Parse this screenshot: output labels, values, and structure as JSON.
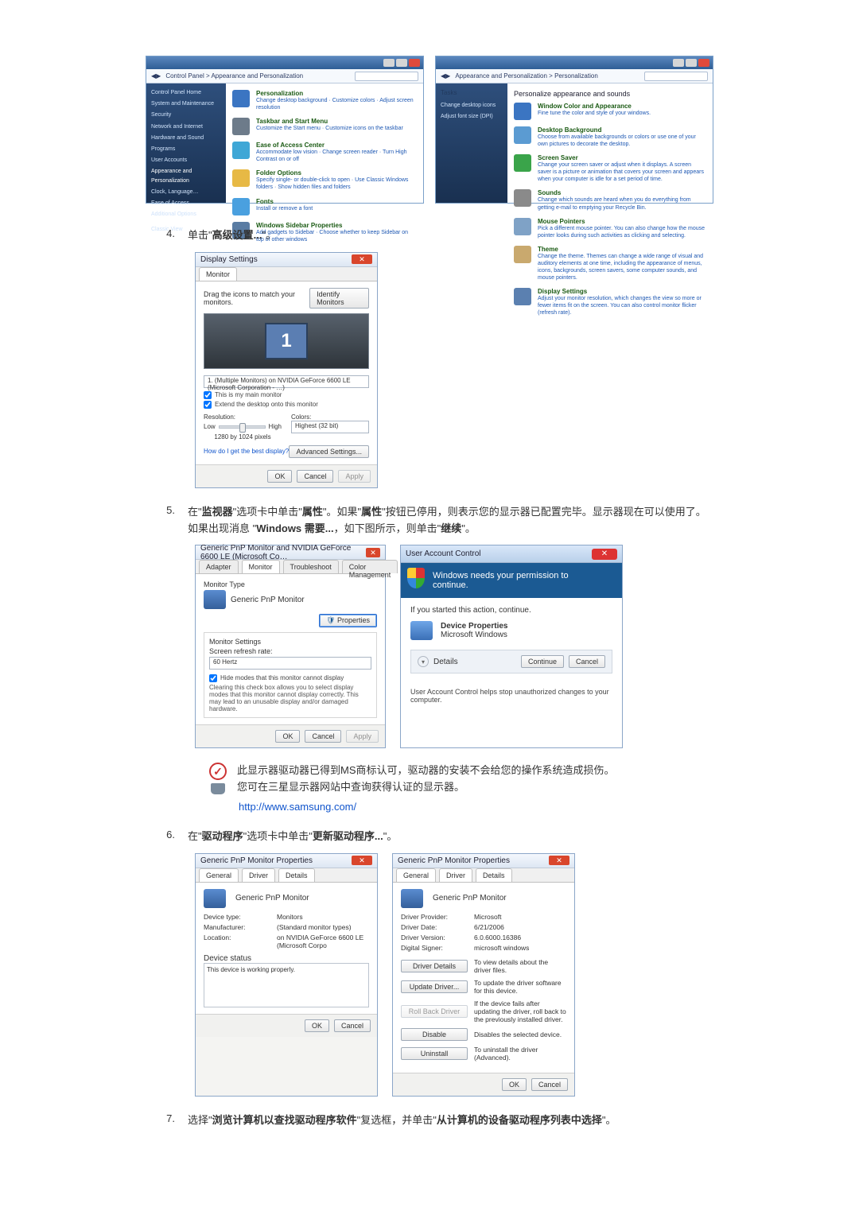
{
  "cp1": {
    "addr": "Control Panel > Appearance and Personalization",
    "side": [
      "Control Panel Home",
      "System and Maintenance",
      "Security",
      "Network and Internet",
      "Hardware and Sound",
      "Programs",
      "User Accounts",
      "Appearance and Personalization",
      "Clock, Language…",
      "Ease of Access",
      "Additional Options",
      "Classic View"
    ],
    "items": [
      {
        "h": "Personalization",
        "s": "Change desktop background · Customize colors · Adjust screen resolution",
        "color": "#3b75c2"
      },
      {
        "h": "Taskbar and Start Menu",
        "s": "Customize the Start menu · Customize icons on the taskbar",
        "color": "#6d7b8a"
      },
      {
        "h": "Ease of Access Center",
        "s": "Accommodate low vision · Change screen reader · Turn High Contrast on or off",
        "color": "#3fa7d6"
      },
      {
        "h": "Folder Options",
        "s": "Specify single- or double-click to open · Use Classic Windows folders · Show hidden files and folders",
        "color": "#e7b945"
      },
      {
        "h": "Fonts",
        "s": "Install or remove a font",
        "color": "#4aa0df"
      },
      {
        "h": "Windows Sidebar Properties",
        "s": "Add gadgets to Sidebar · Choose whether to keep Sidebar on top of other windows",
        "color": "#5a7ca3"
      }
    ]
  },
  "cp2": {
    "addr": "Appearance and Personalization > Personalization",
    "task_head": "Tasks",
    "side": [
      "Change desktop icons",
      "Adjust font size (DPI)"
    ],
    "main_head": "Personalize appearance and sounds",
    "items": [
      {
        "h": "Window Color and Appearance",
        "s": "Fine tune the color and style of your windows.",
        "color": "#3b75c2"
      },
      {
        "h": "Desktop Background",
        "s": "Choose from available backgrounds or colors or use one of your own pictures to decorate the desktop.",
        "color": "#5b9bd2"
      },
      {
        "h": "Screen Saver",
        "s": "Change your screen saver or adjust when it displays. A screen saver is a picture or animation that covers your screen and appears when your computer is idle for a set period of time.",
        "color": "#3aa44a"
      },
      {
        "h": "Sounds",
        "s": "Change which sounds are heard when you do everything from getting e-mail to emptying your Recycle Bin.",
        "color": "#8a8a8a"
      },
      {
        "h": "Mouse Pointers",
        "s": "Pick a different mouse pointer. You can also change how the mouse pointer looks during such activities as clicking and selecting.",
        "color": "#7fa2c6"
      },
      {
        "h": "Theme",
        "s": "Change the theme. Themes can change a wide range of visual and auditory elements at one time, including the appearance of menus, icons, backgrounds, screen savers, some computer sounds, and mouse pointers.",
        "color": "#c9a96e"
      },
      {
        "h": "Display Settings",
        "s": "Adjust your monitor resolution, which changes the view so more or fewer items fit on the screen. You can also control monitor flicker (refresh rate).",
        "color": "#5b80b0"
      }
    ]
  },
  "step4": {
    "num": "4.",
    "text_a": "单击\"",
    "bold": "高级设置...",
    "text_b": "\"。"
  },
  "ds": {
    "title": "Display Settings",
    "tab": "Monitor",
    "drag": "Drag the icons to match your monitors.",
    "identify": "Identify Monitors",
    "mon_num": "1",
    "mon_sel": "1. (Multiple Monitors) on NVIDIA GeForce 6600 LE (Microsoft Corporation - …)",
    "chk1": "This is my main monitor",
    "chk2": "Extend the desktop onto this monitor",
    "res_label": "Resolution:",
    "low": "Low",
    "high": "High",
    "res_val": "1280 by 1024 pixels",
    "col_label": "Colors:",
    "col_val": "Highest (32 bit)",
    "help": "How do I get the best display?",
    "adv": "Advanced Settings...",
    "ok": "OK",
    "cancel": "Cancel",
    "apply": "Apply"
  },
  "step5": {
    "num": "5.",
    "l1a": "在\"",
    "b1": "监视器",
    "l1b": "\"选项卡中单击\"",
    "b2": "属性",
    "l1c": "\"。如果\"",
    "b3": "属性",
    "l1d": "\"按钮已停用，则表示您的显示器已配置完毕。显示器现在可以使用了。",
    "l2a": "如果出现消息 \"",
    "b4": "Windows 需要...",
    "l2b": "，如下图所示，则单击\"",
    "b5": "继续",
    "l2c": "\"。"
  },
  "mp": {
    "title": "Generic PnP Monitor and NVIDIA GeForce 6600 LE (Microsoft Co…",
    "tabs": [
      "Adapter",
      "Monitor",
      "Troubleshoot",
      "Color Management"
    ],
    "type_label": "Monitor Type",
    "type_val": "Generic PnP Monitor",
    "prop_btn": "Properties",
    "settings_label": "Monitor Settings",
    "refresh_label": "Screen refresh rate:",
    "refresh_val": "60 Hertz",
    "hide_chk": "Hide modes that this monitor cannot display",
    "hide_desc": "Clearing this check box allows you to select display modes that this monitor cannot display correctly. This may lead to an unusable display and/or damaged hardware.",
    "ok": "OK",
    "cancel": "Cancel",
    "apply": "Apply"
  },
  "uac": {
    "title": "User Account Control",
    "band": "Windows needs your permission to continue.",
    "if": "If you started this action, continue.",
    "dev": "Device Properties",
    "pub": "Microsoft Windows",
    "details": "Details",
    "cont": "Continue",
    "cancel": "Cancel",
    "foot": "User Account Control helps stop unauthorized changes to your computer."
  },
  "info": {
    "l1": "此显示器驱动器已得到MS商标认可，驱动器的安装不会给您的操作系统造成损伤。",
    "l2": "您可在三星显示器网站中查询获得认证的显示器。",
    "url": "http://www.samsung.com/"
  },
  "step6": {
    "num": "6.",
    "a": "在\"",
    "b1": "驱动程序",
    "b": "\"选项卡中单击\"",
    "b2": "更新驱动程序...",
    "c": "\"。"
  },
  "drvA": {
    "title": "Generic PnP Monitor Properties",
    "tabs": [
      "General",
      "Driver",
      "Details"
    ],
    "name": "Generic PnP Monitor",
    "rows": [
      {
        "k": "Device type:",
        "v": "Monitors"
      },
      {
        "k": "Manufacturer:",
        "v": "(Standard monitor types)"
      },
      {
        "k": "Location:",
        "v": "on NVIDIA GeForce 6600 LE (Microsoft Corpo"
      }
    ],
    "status_label": "Device status",
    "status": "This device is working properly.",
    "ok": "OK",
    "cancel": "Cancel"
  },
  "drvB": {
    "title": "Generic PnP Monitor Properties",
    "tabs": [
      "General",
      "Driver",
      "Details"
    ],
    "name": "Generic PnP Monitor",
    "rows": [
      {
        "k": "Driver Provider:",
        "v": "Microsoft"
      },
      {
        "k": "Driver Date:",
        "v": "6/21/2006"
      },
      {
        "k": "Driver Version:",
        "v": "6.0.6000.16386"
      },
      {
        "k": "Digital Signer:",
        "v": "microsoft windows"
      }
    ],
    "btns": [
      {
        "b": "Driver Details",
        "d": "To view details about the driver files."
      },
      {
        "b": "Update Driver...",
        "d": "To update the driver software for this device."
      },
      {
        "b": "Roll Back Driver",
        "d": "If the device fails after updating the driver, roll back to the previously installed driver."
      },
      {
        "b": "Disable",
        "d": "Disables the selected device."
      },
      {
        "b": "Uninstall",
        "d": "To uninstall the driver (Advanced)."
      }
    ],
    "ok": "OK",
    "cancel": "Cancel"
  },
  "step7": {
    "num": "7.",
    "a": "选择\"",
    "b1": "浏览计算机以查找驱动程序软件",
    "b": "\"复选框，并单击\"",
    "b2": "从计算机的设备驱动程序列表中选择",
    "c": "\"。"
  }
}
